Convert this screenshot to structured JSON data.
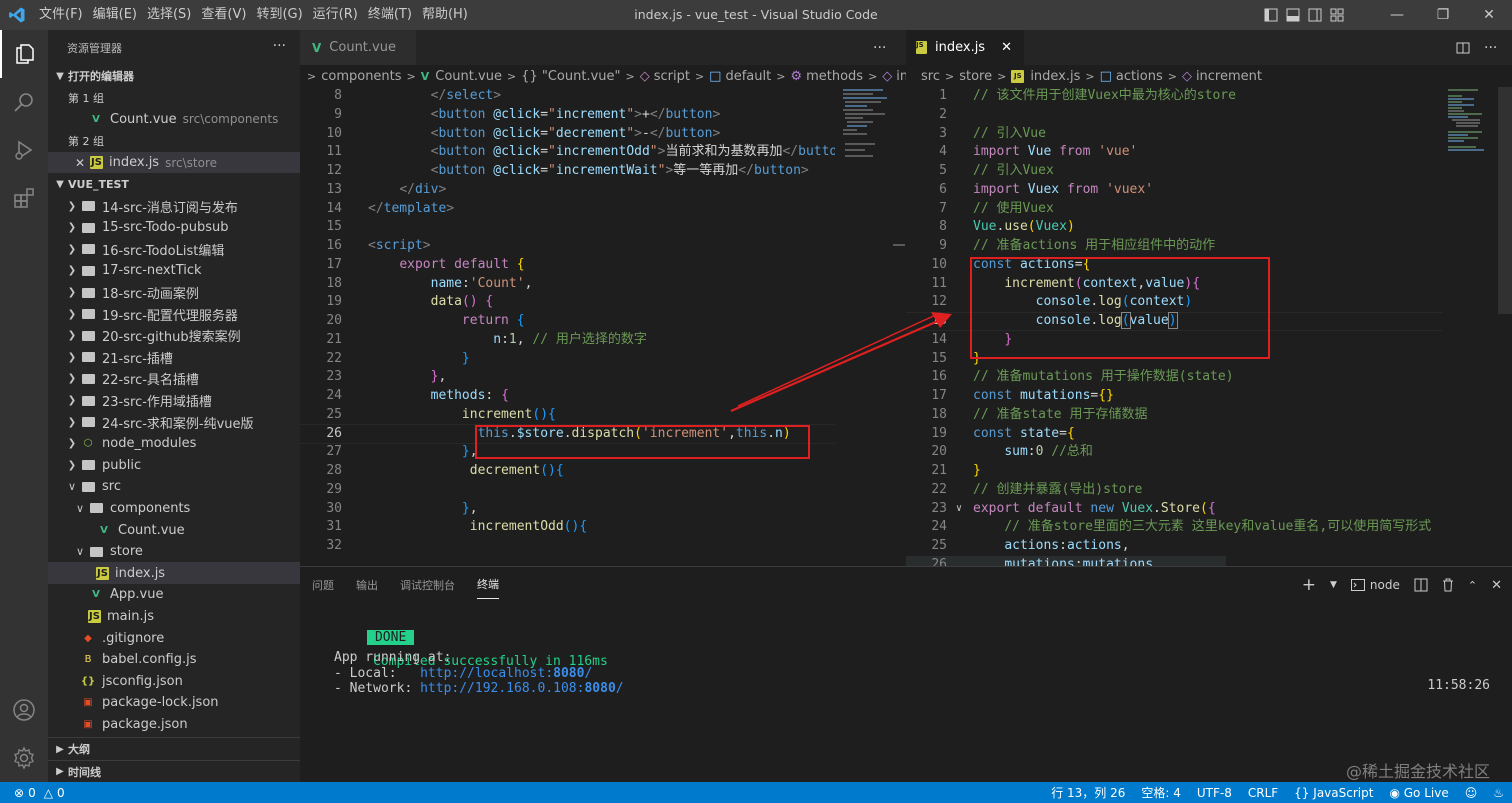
{
  "titlebar": {
    "menu": [
      "文件(F)",
      "编辑(E)",
      "选择(S)",
      "查看(V)",
      "转到(G)",
      "运行(R)",
      "终端(T)",
      "帮助(H)"
    ],
    "title": "index.js - vue_test - Visual Studio Code"
  },
  "sidebar": {
    "title": "资源管理器",
    "open_editors_label": "打开的编辑器",
    "group1_label": "第 1 组",
    "group1_file": "Count.vue",
    "group1_path": "src\\components",
    "group2_label": "第 2 组",
    "group2_file": "index.js",
    "group2_path": "src\\store",
    "project_label": "VUE_TEST",
    "tree": [
      {
        "label": "14-src-消息订阅与发布",
        "kind": "folder"
      },
      {
        "label": "15-src-Todo-pubsub",
        "kind": "folder"
      },
      {
        "label": "16-src-TodoList编辑",
        "kind": "folder"
      },
      {
        "label": "17-src-nextTick",
        "kind": "folder"
      },
      {
        "label": "18-src-动画案例",
        "kind": "folder"
      },
      {
        "label": "19-src-配置代理服务器",
        "kind": "folder"
      },
      {
        "label": "20-src-github搜索案例",
        "kind": "folder"
      },
      {
        "label": "21-src-插槽",
        "kind": "folder"
      },
      {
        "label": "22-src-具名插槽",
        "kind": "folder"
      },
      {
        "label": "23-src-作用域插槽",
        "kind": "folder"
      },
      {
        "label": "24-src-求和案例-纯vue版",
        "kind": "folder"
      },
      {
        "label": "node_modules",
        "kind": "folder"
      },
      {
        "label": "public",
        "kind": "folder"
      },
      {
        "label": "src",
        "kind": "folder-open"
      },
      {
        "label": "components",
        "kind": "folder-open"
      },
      {
        "label": "Count.vue",
        "kind": "vue"
      },
      {
        "label": "store",
        "kind": "folder-open"
      },
      {
        "label": "index.js",
        "kind": "js"
      },
      {
        "label": "App.vue",
        "kind": "vue"
      },
      {
        "label": "main.js",
        "kind": "js"
      },
      {
        "label": ".gitignore",
        "kind": "git"
      },
      {
        "label": "babel.config.js",
        "kind": "babel"
      },
      {
        "label": "jsconfig.json",
        "kind": "json"
      },
      {
        "label": "package-lock.json",
        "kind": "pkg"
      },
      {
        "label": "package.json",
        "kind": "pkg"
      }
    ],
    "outline_label": "大纲",
    "timeline_label": "时间线"
  },
  "left_editor": {
    "tab_label": "Count.vue",
    "breadcrumb": [
      "components",
      "Count.vue",
      "{} \"Count.vue\"",
      "script",
      "default",
      "methods",
      "increment"
    ],
    "line_numbers": [
      "8",
      "9",
      "10",
      "11",
      "12",
      "13",
      "14",
      "15",
      "16",
      "17",
      "18",
      "19",
      "20",
      "21",
      "22",
      "23",
      "24",
      "25",
      "26",
      "27",
      "28",
      "29",
      "30",
      "31",
      "32"
    ],
    "current_line": "26"
  },
  "right_editor": {
    "tab_label": "index.js",
    "breadcrumb": [
      "src",
      "store",
      "index.js",
      "actions",
      "increment"
    ],
    "line_numbers": [
      "1",
      "2",
      "3",
      "4",
      "5",
      "6",
      "7",
      "8",
      "9",
      "10",
      "11",
      "12",
      "13",
      "14",
      "15",
      "16",
      "17",
      "18",
      "19",
      "20",
      "21",
      "22",
      "23",
      "24",
      "25",
      "26"
    ],
    "current_line": "13"
  },
  "panel": {
    "tabs": [
      "问题",
      "输出",
      "调试控制台",
      "终端"
    ],
    "active_tab": "终端",
    "shell_label": "node",
    "done_label": "DONE",
    "compiled_text": "Compiled successfully in 116ms",
    "time": "11:58:26",
    "app_running": "App running at:",
    "local_label": "- Local:   ",
    "local_url_prefix": "http://localhost:",
    "local_port": "8080",
    "network_label": "- Network: ",
    "network_url_prefix": "http://192.168.0.108:",
    "network_port": "8080",
    "url_suffix": "/"
  },
  "statusbar": {
    "errors": "0",
    "warnings": "0",
    "position": "行 13，列 26",
    "spaces": "空格: 4",
    "encoding": "UTF-8",
    "eol": "CRLF",
    "language": "JavaScript",
    "golive": "Go Live"
  },
  "watermark": "@稀土掘金技术社区",
  "colors": {
    "accent": "#007acc",
    "annotation": "#e02020"
  }
}
